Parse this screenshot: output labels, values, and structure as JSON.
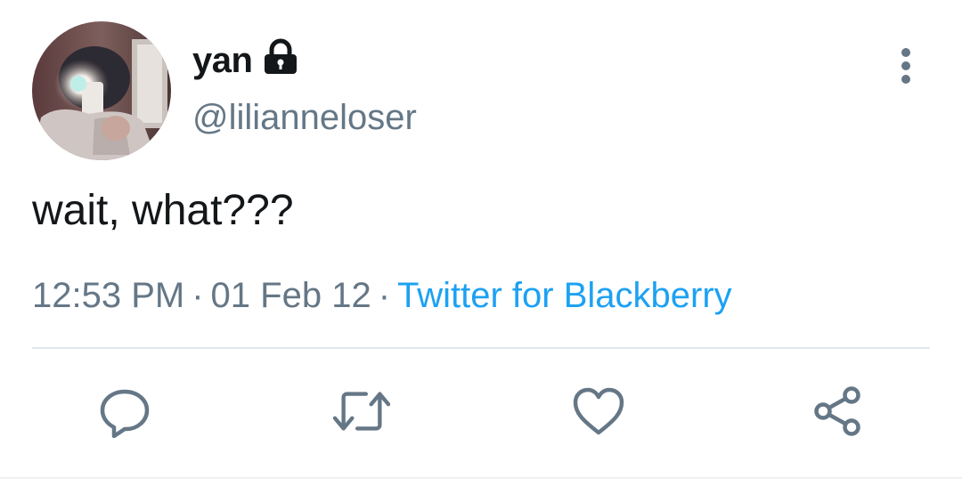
{
  "colors": {
    "primary_text": "#14171a",
    "secondary_text": "#657786",
    "link": "#1da1f2",
    "divider": "#e1e8ed"
  },
  "user": {
    "display_name": "yan",
    "handle": "@lilianneloser",
    "protected_icon": "lock-icon",
    "avatar_icon": "avatar-photo"
  },
  "menu": {
    "icon": "more-vertical-icon"
  },
  "tweet": {
    "text": "wait, what???",
    "time": "12:53 PM",
    "date": "01 Feb 12",
    "separator": "·",
    "source": "Twitter for Blackberry"
  },
  "actions": [
    {
      "name": "reply",
      "icon": "reply-icon"
    },
    {
      "name": "retweet",
      "icon": "retweet-icon"
    },
    {
      "name": "like",
      "icon": "heart-icon"
    },
    {
      "name": "share",
      "icon": "share-icon"
    }
  ]
}
